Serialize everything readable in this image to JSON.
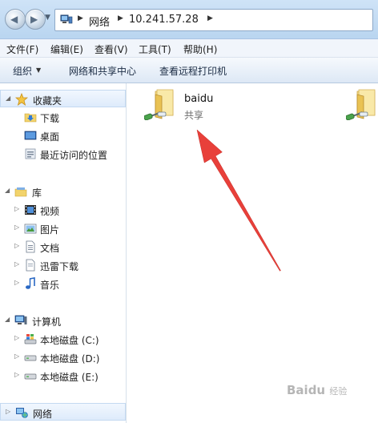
{
  "address": {
    "crumbs": [
      "网络",
      "10.241.57.28"
    ]
  },
  "menu": [
    "文件(F)",
    "编辑(E)",
    "查看(V)",
    "工具(T)",
    "帮助(H)"
  ],
  "commands": {
    "organize": "组织",
    "network_center": "网络和共享中心",
    "remote_printers": "查看远程打印机"
  },
  "nav": {
    "favorites": "收藏夹",
    "favorites_items": [
      "下载",
      "桌面",
      "最近访问的位置"
    ],
    "library": "库",
    "library_items": [
      "视频",
      "图片",
      "文档",
      "迅雷下载",
      "音乐"
    ],
    "computer": "计算机",
    "computer_items": [
      "本地磁盘 (C:)",
      "本地磁盘 (D:)",
      "本地磁盘 (E:)"
    ],
    "network": "网络"
  },
  "shares": [
    {
      "name": "baidu",
      "subtitle": "共享"
    }
  ],
  "watermark": {
    "text": "Baidu",
    "sub": "经验"
  },
  "colors": {
    "arrow": "#e8403a",
    "selection": "#deebfb",
    "folder": "#f2d36b"
  }
}
